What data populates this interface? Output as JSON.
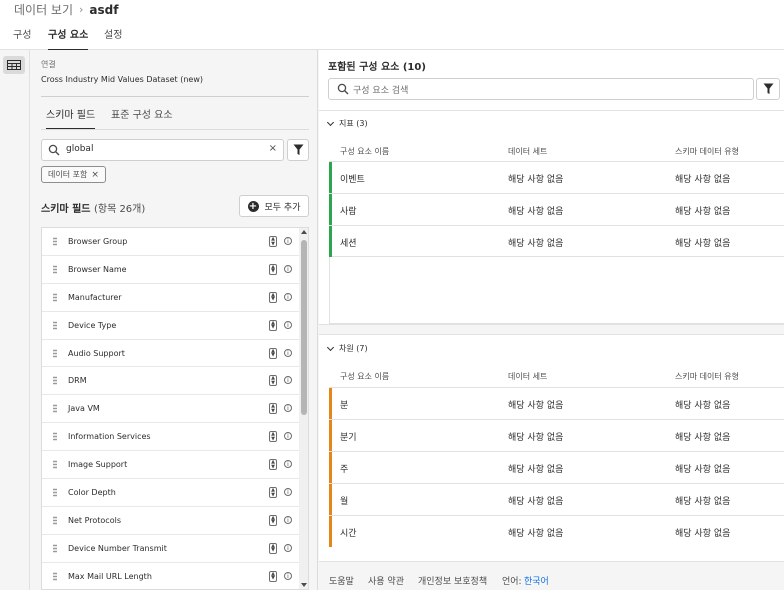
{
  "breadcrumb": {
    "parent": "데이터 보기",
    "separator": "›",
    "current": "asdf"
  },
  "tabs": [
    "구성",
    "구성 요소",
    "설정"
  ],
  "left": {
    "connection_label": "연결",
    "connection_name": "Cross Industry Mid Values Dataset (new)",
    "tabs": [
      "스키마 필드",
      "표준 구성 요소"
    ],
    "search_value": "global",
    "clear_glyph": "×",
    "chip_label": "데이터 포함",
    "chip_close": "×",
    "fields_title": "스키마 필드",
    "fields_count": "(항목 26개)",
    "add_all_label": "모두 추가",
    "fields": [
      "Browser Group",
      "Browser Name",
      "Manufacturer",
      "Device Type",
      "Audio Support",
      "DRM",
      "Java VM",
      "Information Services",
      "Image Support",
      "Color Depth",
      "Net Protocols",
      "Device Number Transmit",
      "Max Mail URL Length"
    ]
  },
  "right": {
    "title": "포함된 구성 요소 (10)",
    "search_placeholder": "구성 요소 검색",
    "columns": [
      "구성 요소 이름",
      "데이터 세트",
      "스키마 데이터 유형"
    ],
    "metrics": {
      "header": "지표 (3)",
      "color": "#2da44e",
      "rows": [
        [
          "이벤트",
          "해당 사항 없음",
          "해당 사항 없음"
        ],
        [
          "사람",
          "해당 사항 없음",
          "해당 사항 없음"
        ],
        [
          "세션",
          "해당 사항 없음",
          "해당 사항 없음"
        ]
      ]
    },
    "dimensions": {
      "header": "차원 (7)",
      "color": "#e68619",
      "rows": [
        [
          "분",
          "해당 사항 없음",
          "해당 사항 없음"
        ],
        [
          "분기",
          "해당 사항 없음",
          "해당 사항 없음"
        ],
        [
          "주",
          "해당 사항 없음",
          "해당 사항 없음"
        ],
        [
          "월",
          "해당 사항 없음",
          "해당 사항 없음"
        ],
        [
          "시간",
          "해당 사항 없음",
          "해당 사항 없음"
        ]
      ]
    }
  },
  "footer": {
    "help": "도움말",
    "terms": "사용 약관",
    "privacy": "개인정보 보호정책",
    "language_label": "언어:",
    "language": "한국어"
  }
}
